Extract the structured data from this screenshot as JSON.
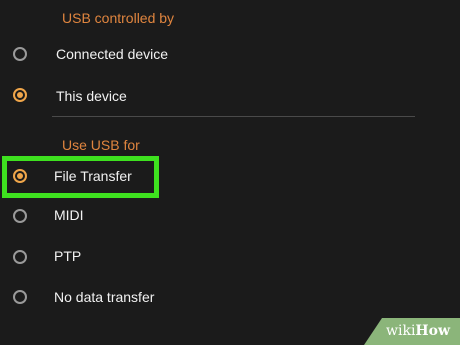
{
  "usb_controlled_by": {
    "title": "USB controlled by",
    "options": [
      {
        "label": "Connected device",
        "selected": false
      },
      {
        "label": "This device",
        "selected": true
      }
    ]
  },
  "use_usb_for": {
    "title": "Use USB for",
    "options": [
      {
        "label": "File Transfer",
        "selected": true
      },
      {
        "label": "MIDI",
        "selected": false
      },
      {
        "label": "PTP",
        "selected": false
      },
      {
        "label": "No data transfer",
        "selected": false
      }
    ]
  },
  "watermark": {
    "prefix": "wiki",
    "suffix": "How"
  },
  "colors": {
    "background": "#1b1b1b",
    "accent": "#f0a64a",
    "section_title": "#e0853f",
    "highlight": "#3ee11f"
  }
}
